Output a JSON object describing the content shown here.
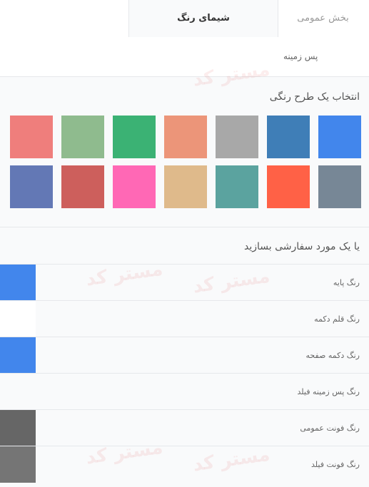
{
  "tabs": {
    "general": "بخش عمومی",
    "theme": "شیمای رنگ"
  },
  "subtab": {
    "background": "پس زمینه"
  },
  "preset": {
    "title": "انتخاب یک طرح رنگی",
    "colors": [
      "#4286ec",
      "#3f7eb7",
      "#a8a8a8",
      "#ec9579",
      "#3bb274",
      "#8fbb8e",
      "#ef7e7c",
      "#778796",
      "#ff6146",
      "#5ba39f",
      "#dfba8b",
      "#ff68b5",
      "#cd5f5c",
      "#6378b5"
    ]
  },
  "custom": {
    "title": "یا یک مورد سفارشی بسازید",
    "rows": [
      {
        "label": "رنگ پایه",
        "color": "#4286ec"
      },
      {
        "label": "رنگ قلم دکمه",
        "color": "#ffffff"
      },
      {
        "label": "رنگ دکمه صفحه",
        "color": "#4286ec"
      },
      {
        "label": "رنگ پس زمینه فیلد",
        "color": "#f9fafb"
      },
      {
        "label": "رنگ فونت عمومی",
        "color": "#666666"
      },
      {
        "label": "رنگ فونت فیلد",
        "color": "#757575"
      }
    ]
  },
  "watermark": "مستر کد"
}
